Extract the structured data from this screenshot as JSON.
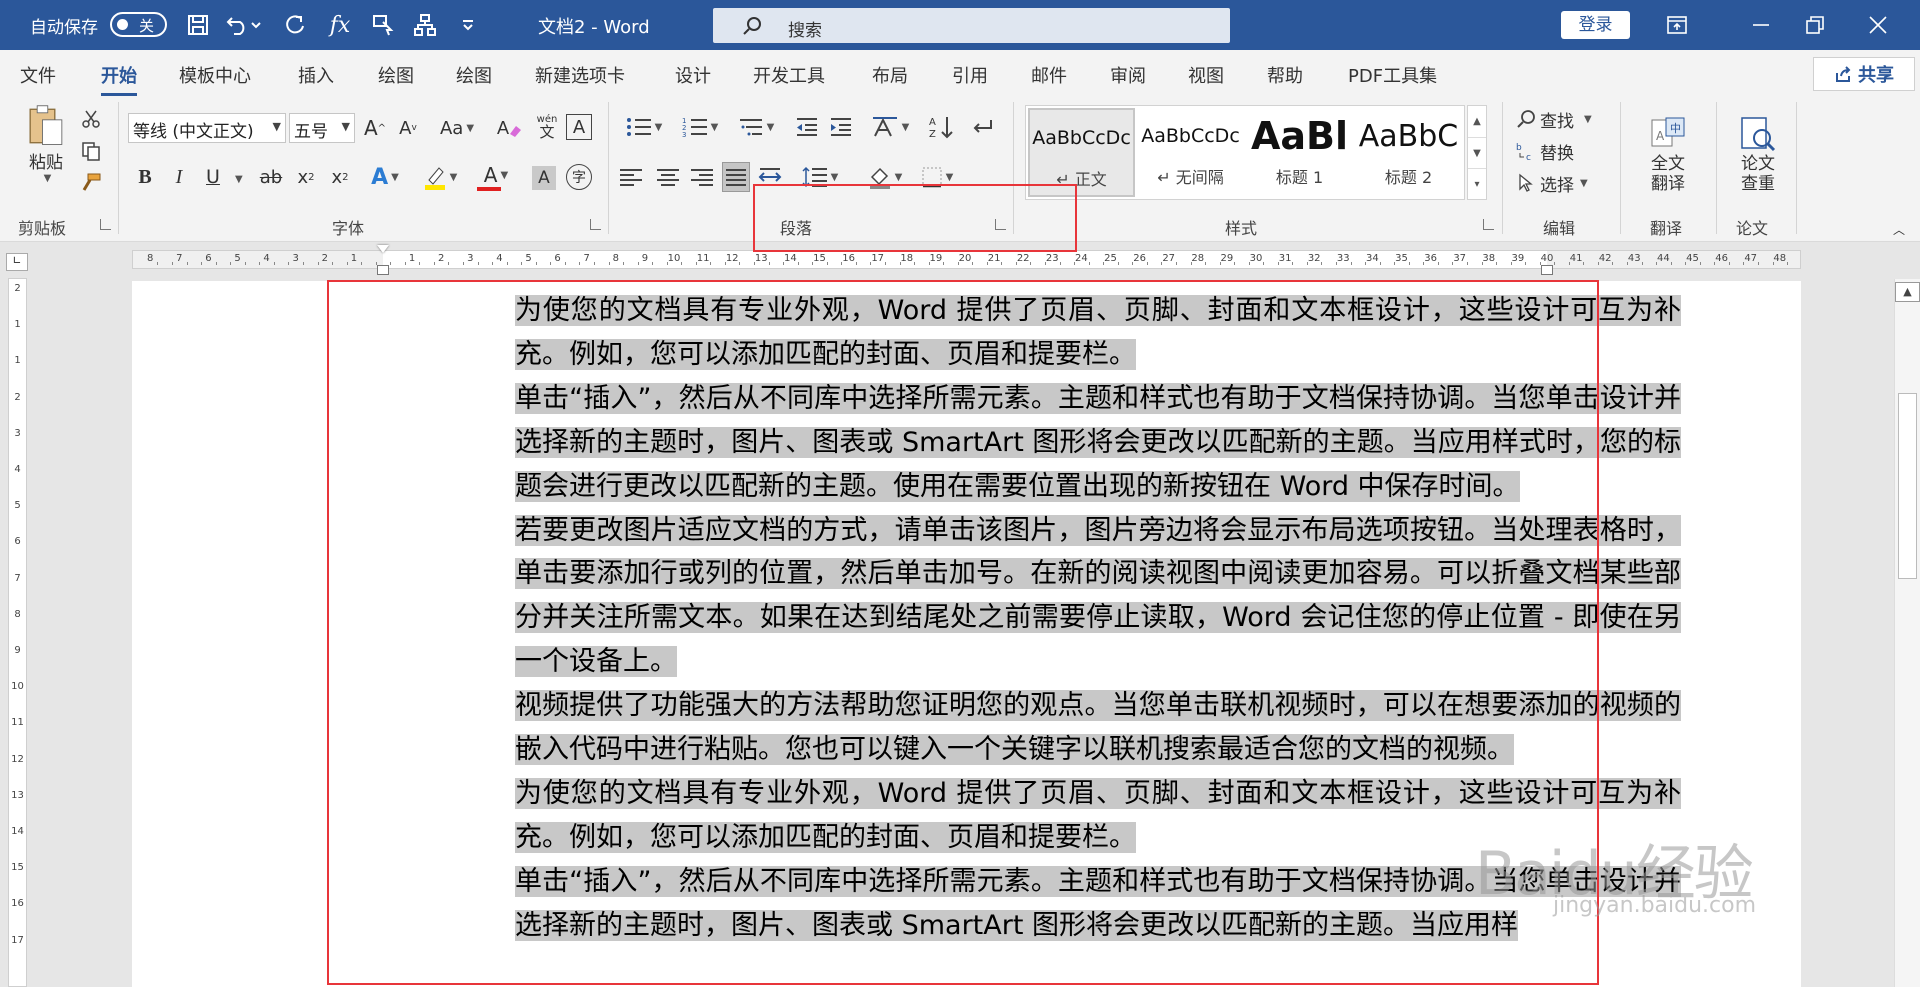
{
  "titlebar": {
    "autosave_label": "自动保存",
    "autosave_state": "关",
    "doc_title": "文档2  -  Word",
    "search_placeholder": "搜索",
    "login_label": "登录"
  },
  "tabs": [
    "文件",
    "开始",
    "模板中心",
    "插入",
    "绘图",
    "绘图",
    "新建选项卡",
    "设计",
    "开发工具",
    "布局",
    "引用",
    "邮件",
    "审阅",
    "视图",
    "帮助",
    "PDF工具集"
  ],
  "share_label": "共享",
  "ribbon": {
    "clipboard": {
      "paste_label": "粘贴",
      "group_label": "剪贴板"
    },
    "font": {
      "font_name": "等线 (中文正文)",
      "font_size": "五号",
      "grow": "A",
      "shrink": "A",
      "case_btn": "Aa",
      "phonetic_top": "wén",
      "phonetic_bottom": "文",
      "border_char": "A",
      "bold": "B",
      "italic": "I",
      "underline": "U",
      "strike": "ab",
      "sub": "x",
      "sup": "x",
      "effect": "A",
      "font_color": "A",
      "shade": "A",
      "enclose": "字",
      "group_label": "字体"
    },
    "paragraph": {
      "group_label": "段落"
    },
    "styles": {
      "items": [
        {
          "sample": "AaBbCcDc",
          "name": "↵ 正文"
        },
        {
          "sample": "AaBbCcDc",
          "name": "↵ 无间隔"
        },
        {
          "sample": "AaBl",
          "name": "标题 1"
        },
        {
          "sample": "AaBbC",
          "name": "标题 2"
        }
      ],
      "group_label": "样式"
    },
    "editing": {
      "find": "查找",
      "replace": "替换",
      "select": "选择",
      "group_label": "编辑"
    },
    "translate": {
      "btn_line1": "全文",
      "btn_line2": "翻译",
      "group_label": "翻译"
    },
    "paper": {
      "btn_line1": "论文",
      "btn_line2": "查重",
      "group_label": "论文"
    }
  },
  "ruler": {
    "left_numbers": [
      "8",
      "7",
      "6",
      "5",
      "4",
      "3",
      "2",
      "1"
    ],
    "right_numbers": [
      "1",
      "2",
      "3",
      "4",
      "5",
      "6",
      "7",
      "8",
      "9",
      "10",
      "11",
      "12",
      "13",
      "14",
      "15",
      "16",
      "17",
      "18",
      "19",
      "20",
      "21",
      "22",
      "23",
      "24",
      "25",
      "26",
      "27",
      "28",
      "29",
      "30",
      "31",
      "32",
      "33",
      "34",
      "35",
      "36",
      "37",
      "38",
      "39",
      "40",
      "41",
      "42",
      "43",
      "44",
      "45",
      "46",
      "47",
      "48"
    ],
    "vertical_numbers": [
      "2",
      "1",
      "1",
      "2",
      "3",
      "4",
      "5",
      "6",
      "7",
      "8",
      "9",
      "10",
      "11",
      "12",
      "13",
      "14",
      "15",
      "16",
      "17"
    ]
  },
  "document": {
    "paragraphs": [
      "为使您的文档具有专业外观，Word 提供了页眉、页脚、封面和文本框设计，这些设计可互为补充。例如，您可以添加匹配的封面、页眉和提要栏。",
      "单击“插入”，然后从不同库中选择所需元素。主题和样式也有助于文档保持协调。当您单击设计并选择新的主题时，图片、图表或 SmartArt 图形将会更改以匹配新的主题。当应用样式时，您的标题会进行更改以匹配新的主题。使用在需要位置出现的新按钮在 Word 中保存时间。",
      "若要更改图片适应文档的方式，请单击该图片，图片旁边将会显示布局选项按钮。当处理表格时，单击要添加行或列的位置，然后单击加号。在新的阅读视图中阅读更加容易。可以折叠文档某些部分并关注所需文本。如果在达到结尾处之前需要停止读取，Word 会记住您的停止位置 - 即使在另一个设备上。",
      "视频提供了功能强大的方法帮助您证明您的观点。当您单击联机视频时，可以在想要添加的视频的嵌入代码中进行粘贴。您也可以键入一个关键字以联机搜索最适合您的文档的视频。",
      "为使您的文档具有专业外观，Word 提供了页眉、页脚、封面和文本框设计，这些设计可互为补充。例如，您可以添加匹配的封面、页眉和提要栏。",
      "单击“插入”，然后从不同库中选择所需元素。主题和样式也有助于文档保持协调。当您单击设计并选择新的主题时，图片、图表或 SmartArt 图形将会更改以匹配新的主题。当应用样"
    ]
  },
  "watermark": {
    "text": "Baidu经验",
    "url": "jingyan.baidu.com"
  },
  "colors": {
    "accent": "#2b579a",
    "annotation": "#e8353a",
    "selection": "#c8c8c8"
  }
}
